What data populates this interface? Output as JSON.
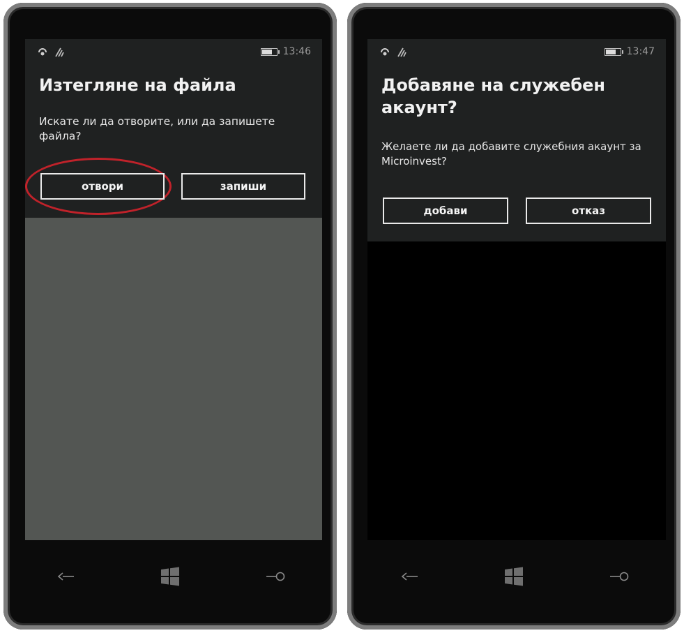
{
  "screens": [
    {
      "status_time": "13:46",
      "title": "Изтегляне на файла",
      "body": "Искате ли да отворите, или да запишете файла?",
      "button_primary": "отвори",
      "button_secondary": "запиши"
    },
    {
      "status_time": "13:47",
      "title": "Добавяне на служебен акаунт?",
      "body": "Желаете ли да добавите служебния акаунт за Microinvest?",
      "button_primary": "добави",
      "button_secondary": "отказ"
    }
  ],
  "icons": {
    "status_left": [
      "nfc-icon",
      "wifi-icon"
    ],
    "status_right": [
      "battery-icon"
    ],
    "nav": [
      "back-arrow-icon",
      "windows-logo-icon",
      "search-icon"
    ]
  },
  "colors": {
    "dialog_bg": "#1f2121",
    "left_lower_bg": "#535653",
    "highlight": "#c0222a"
  }
}
